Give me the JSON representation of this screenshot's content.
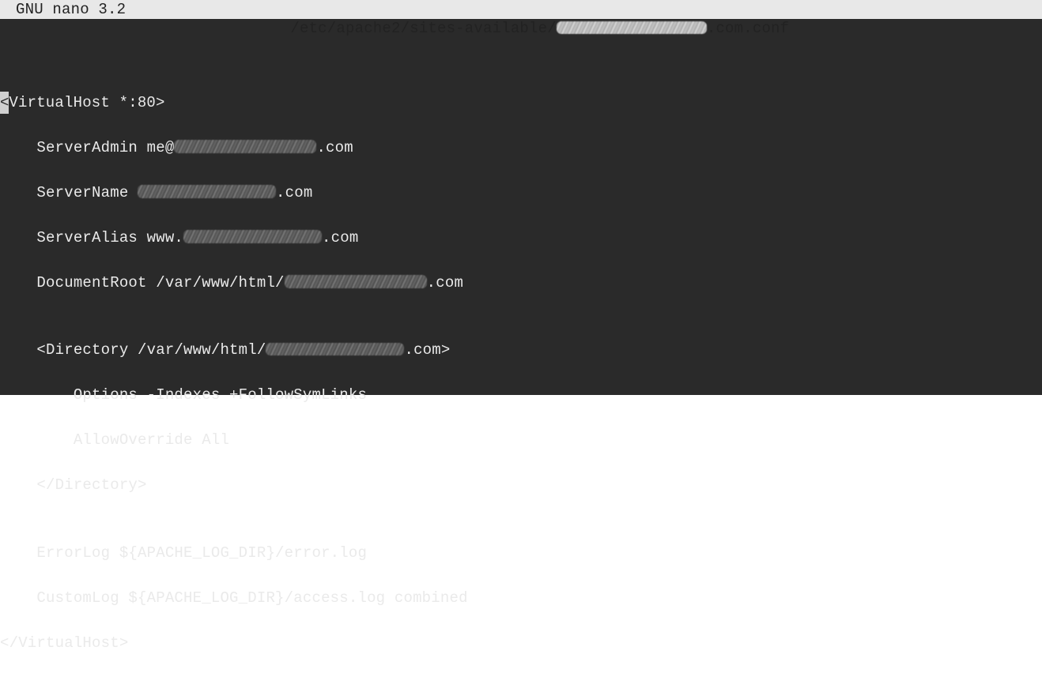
{
  "titlebar": {
    "app_name": "GNU nano 3.2",
    "file_path_prefix": "/etc/apache2/sites-available/",
    "file_path_suffix": ".com.conf"
  },
  "editor": {
    "l01a": "<",
    "l01b": "VirtualHost *:80>",
    "l02a": "    ServerAdmin me@",
    "l02b": ".com",
    "l03a": "    ServerName ",
    "l03b": ".com",
    "l04a": "    ServerAlias www.",
    "l04b": ".com",
    "l05a": "    DocumentRoot /var/www/html/",
    "l05b": ".com",
    "l06": "",
    "l07a": "    <Directory /var/www/html/",
    "l07b": ".com>",
    "l08": "        Options -Indexes +FollowSymLinks",
    "l09": "        AllowOverride All",
    "l10": "    </Directory>",
    "l11": "",
    "l12": "    ErrorLog ${APACHE_LOG_DIR}/error.log",
    "l13": "    CustomLog ${APACHE_LOG_DIR}/access.log combined",
    "l14": "</VirtualHost>"
  },
  "redaction_widths": {
    "title": "190px",
    "admin": "180px",
    "name": "175px",
    "alias": "175px",
    "docroot": "180px",
    "directory": "175px"
  }
}
